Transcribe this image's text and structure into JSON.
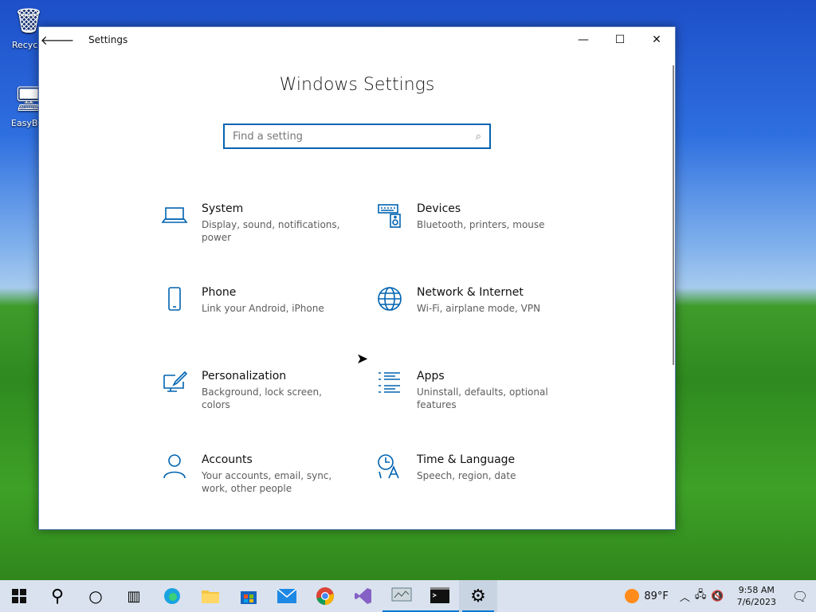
{
  "desktop": {
    "icons": [
      {
        "label": "Recycle"
      },
      {
        "label": "EasyBCI"
      }
    ]
  },
  "window": {
    "title": "Settings",
    "heading": "Windows Settings",
    "search_placeholder": "Find a setting"
  },
  "tiles": [
    {
      "title": "System",
      "desc": "Display, sound, notifications, power"
    },
    {
      "title": "Devices",
      "desc": "Bluetooth, printers, mouse"
    },
    {
      "title": "Phone",
      "desc": "Link your Android, iPhone"
    },
    {
      "title": "Network & Internet",
      "desc": "Wi-Fi, airplane mode, VPN"
    },
    {
      "title": "Personalization",
      "desc": "Background, lock screen, colors"
    },
    {
      "title": "Apps",
      "desc": "Uninstall, defaults, optional features"
    },
    {
      "title": "Accounts",
      "desc": "Your accounts, email, sync, work, other people"
    },
    {
      "title": "Time & Language",
      "desc": "Speech, region, date"
    }
  ],
  "taskbar": {
    "weather": "89°F",
    "time": "9:58 AM",
    "date": "7/6/2023"
  },
  "colors": {
    "accent": "#0063b1"
  }
}
